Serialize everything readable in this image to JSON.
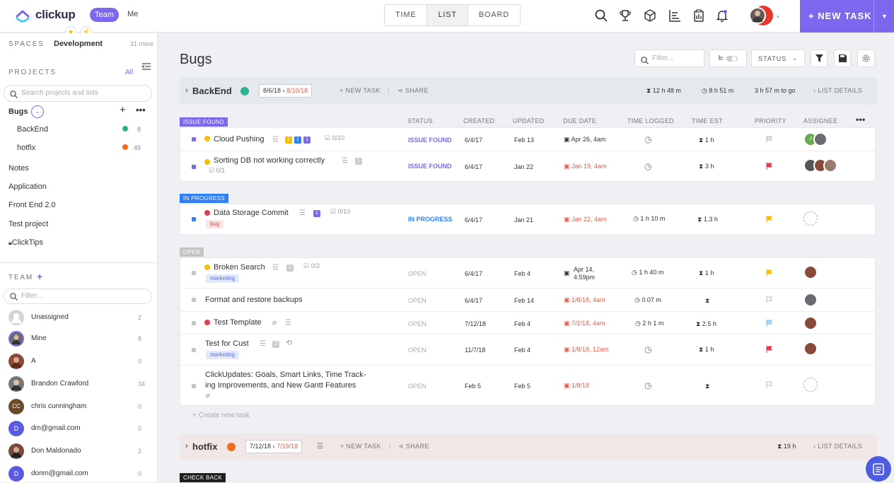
{
  "topbar": {
    "logo_text": "clickup",
    "team_label": "Team",
    "me_label": "Me",
    "view_tabs": [
      "TIME",
      "LIST",
      "BOARD"
    ],
    "active_tab": "LIST",
    "new_task_label": "+ NEW TASK",
    "icons": [
      "search-icon",
      "trophy-icon",
      "cube-icon",
      "chart-icon",
      "clipboard-icon",
      "bell-icon"
    ]
  },
  "sidebar": {
    "spaces_label": "SPACES",
    "space_name": "Development",
    "more_label": "31 more",
    "projects_label": "PROJECTS",
    "all_label": "All",
    "search_placeholder": "Search projects and lists",
    "project_bugs": "Bugs",
    "lists": [
      {
        "name": "BackEnd",
        "count": "8",
        "color": "#2fb08e"
      },
      {
        "name": "hotfix",
        "count": "49",
        "color": "#ef6c1a"
      }
    ],
    "projects": [
      "Notes",
      "Application",
      "Front End 2.0",
      "Test project",
      "ClickTips"
    ],
    "team_label": "TEAM",
    "filter_placeholder": "Filter...",
    "members": [
      {
        "name": "Unassigned",
        "count": "2",
        "color": "#c9c9c9"
      },
      {
        "name": "Mine",
        "count": "8",
        "color": "#6a6a70"
      },
      {
        "name": "A",
        "count": "0",
        "color": "#8a4a3a"
      },
      {
        "name": "Brandon Crawford",
        "count": "34",
        "color": "#555"
      },
      {
        "name": "chris cunningham",
        "count": "0",
        "color": "#6b4a2a",
        "initials": "CC"
      },
      {
        "name": "dm@gmail.com",
        "count": "0",
        "color": "#5a5ae0",
        "initials": "D"
      },
      {
        "name": "Don Maldonado",
        "count": "2",
        "color": "#7a4a3a"
      },
      {
        "name": "donm@gmail.com",
        "count": "0",
        "color": "#5a5ae0",
        "initials": "D"
      }
    ]
  },
  "main": {
    "title": "Bugs",
    "filter_placeholder": "Filter...",
    "status_label": "STATUS",
    "columns": [
      "STATUS",
      "CREATED",
      "UPDATED",
      "DUE DATE",
      "TIME LOGGED",
      "TIME EST",
      "PRIORITY",
      "ASSIGNEE"
    ],
    "groups": [
      {
        "name": "BackEnd",
        "color": "#2fb08e",
        "start": "8/6/18",
        "end": "8/10/18",
        "new_task": "+ NEW TASK",
        "share": "SHARE",
        "logged": "12 h 48 m",
        "est": "8 h 51 m",
        "togo": "3 h 57 m to go",
        "details": "LIST DETAILS"
      },
      {
        "name": "hotfix",
        "color": "#ef6c1a",
        "start": "7/12/18",
        "end": "7/19/18",
        "new_task": "+ NEW TASK",
        "share": "SHARE",
        "est": "19 h",
        "details": "LIST DETAILS"
      }
    ],
    "sections": {
      "issue_found": "ISSUE FOUND",
      "in_progress": "IN PROGRESS",
      "open": "OPEN",
      "check_back": "CHECK BACK"
    },
    "tasks": [
      {
        "name": "Cloud Pushing",
        "status": "ISSUE FOUND",
        "created": "6/4/17",
        "updated": "Feb 13",
        "due": "Apr 26, 4am",
        "time_logged": "",
        "time_est": "1 h",
        "checklist": "0/10",
        "subtasks": [
          "1",
          "1",
          "1"
        ]
      },
      {
        "name": "Sorting DB not working correctly",
        "status": "ISSUE FOUND",
        "created": "6/4/17",
        "updated": "Jan 22",
        "due": "Jan 19, 4am",
        "time_logged": "",
        "time_est": "3 h",
        "checklist": "0/1",
        "subtasks": [
          "1"
        ]
      },
      {
        "name": "Data Storage Commit",
        "status": "IN PROGRESS",
        "created": "6/4/17",
        "updated": "Jan 21",
        "due": "Jan 22, 4am",
        "time_logged": "1 h 10 m",
        "time_est": "1.3 h",
        "checklist": "0/10",
        "tag": "bug",
        "subtasks": [
          "1"
        ]
      },
      {
        "name": "Broken Search",
        "status": "OPEN",
        "created": "6/4/17",
        "updated": "Feb 4",
        "due_line1": "Apr 14,",
        "due_line2": "4:59pm",
        "time_logged": "1 h 40 m",
        "time_est": "1 h",
        "checklist": "0/2",
        "tag": "marketing",
        "subtasks": [
          "1"
        ]
      },
      {
        "name": "Format and restore backups",
        "status": "OPEN",
        "created": "6/4/17",
        "updated": "Feb 14",
        "due": "1/8/18, 4am",
        "time_logged": "0.07 m",
        "time_est": ""
      },
      {
        "name": "Test Template",
        "status": "OPEN",
        "created": "7/12/18",
        "updated": "Feb 4",
        "due": "7/2/18, 4am",
        "time_logged": "2 h 1 m",
        "time_est": "2.5 h"
      },
      {
        "name": "Test for Cust",
        "status": "OPEN",
        "created": "11/7/18",
        "updated": "Feb 4",
        "due": "1/8/18, 12am",
        "time_logged": "",
        "time_est": "1 h",
        "tag": "marketing",
        "subtasks": [
          "2"
        ]
      },
      {
        "name_line1": "ClickUpdates: Goals, Smart Links, Time Track-",
        "name_line2": "ing Improvements, and New Gantt Features",
        "status": "OPEN",
        "created": "Feb 5",
        "updated": "Feb 5",
        "due": "1/8/18",
        "time_logged": "",
        "time_est": ""
      }
    ],
    "create_new_task": "+ Create new task"
  },
  "colors": {
    "accent": "#7b68ee",
    "issue_found": "#7b68ee",
    "in_progress": "#2d7ff9",
    "open": "#c4c4c4",
    "check_back": "#1f1f1f",
    "overdue": "#e8594a",
    "urgent_flag": "#e8384f",
    "high_flag": "#f6c000",
    "normal_flag": "#6fc3f2"
  }
}
